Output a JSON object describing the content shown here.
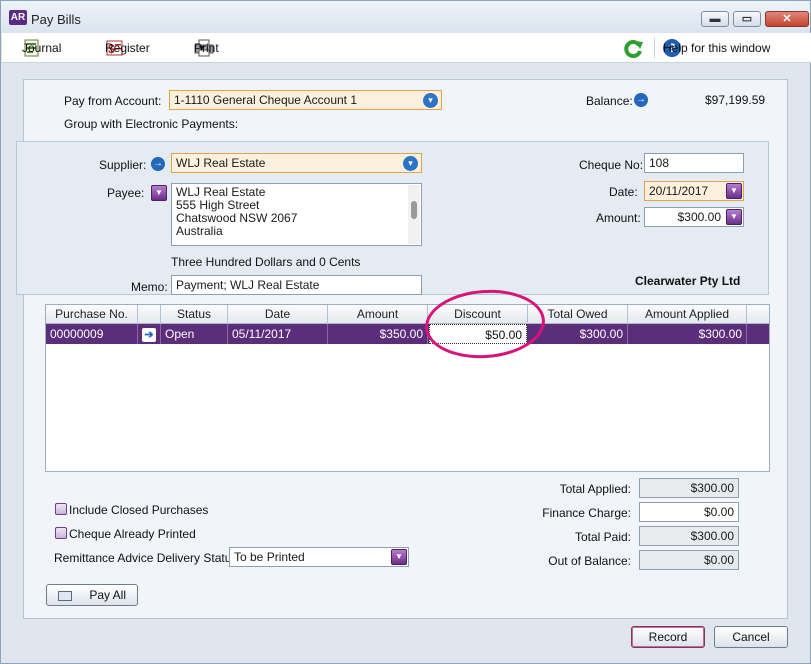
{
  "window": {
    "app_badge": "AR",
    "title": "Pay Bills",
    "controls": {
      "minimize": "▬",
      "maximize": "▭",
      "close": "✕"
    }
  },
  "toolbar": {
    "journal": "Journal",
    "register": "Register",
    "print": "Print",
    "print_caret": "▾",
    "help": "Help for this window",
    "help_icon_glyph": "?",
    "refresh_icon": "refresh-icon"
  },
  "account": {
    "pay_from_label": "Pay from Account:",
    "pay_from_value": "1-1110 General Cheque Account 1",
    "group_label": "Group with Electronic Payments:",
    "balance_label": "Balance:",
    "balance_value": "$97,199.59"
  },
  "supplier_section": {
    "supplier_label": "Supplier:",
    "supplier_value": "WLJ Real Estate",
    "payee_label": "Payee:",
    "payee_lines": [
      "WLJ Real Estate",
      "555 High Street",
      "Chatswood  NSW  2067",
      "Australia"
    ],
    "amount_words": "Three Hundred Dollars and 0 Cents",
    "memo_label": "Memo:",
    "memo_value": "Payment; WLJ Real Estate",
    "cheque_no_label": "Cheque No:",
    "cheque_no_value": "108",
    "date_label": "Date:",
    "date_value": "20/11/2017",
    "amount_label": "Amount:",
    "amount_value": "$300.00",
    "company": "Clearwater Pty Ltd"
  },
  "table": {
    "columns": [
      "Purchase No.",
      "",
      "Status",
      "Date",
      "Amount",
      "Discount",
      "Total Owed",
      "Amount Applied"
    ],
    "rows": [
      {
        "purchase_no": "00000009",
        "status": "Open",
        "date": "05/11/2017",
        "amount": "$350.00",
        "discount": "$50.00",
        "total_owed": "$300.00",
        "amount_applied": "$300.00"
      }
    ]
  },
  "options": {
    "include_closed": "Include Closed Purchases",
    "cheque_printed": "Cheque Already Printed",
    "remittance_label": "Remittance Advice Delivery Status:",
    "remittance_value": "To be Printed",
    "pay_all": "Pay All"
  },
  "totals": {
    "total_applied_label": "Total Applied:",
    "total_applied_value": "$300.00",
    "finance_charge_label": "Finance Charge:",
    "finance_charge_value": "$0.00",
    "total_paid_label": "Total Paid:",
    "total_paid_value": "$300.00",
    "out_of_balance_label": "Out of Balance:",
    "out_of_balance_value": "$0.00"
  },
  "footer": {
    "record": "Record",
    "cancel": "Cancel"
  },
  "colors": {
    "accent_purple": "#5c2d7b",
    "highlight_pink": "#d9137a",
    "field_orange": "#fdf1dd",
    "link_blue": "#2467bb"
  }
}
